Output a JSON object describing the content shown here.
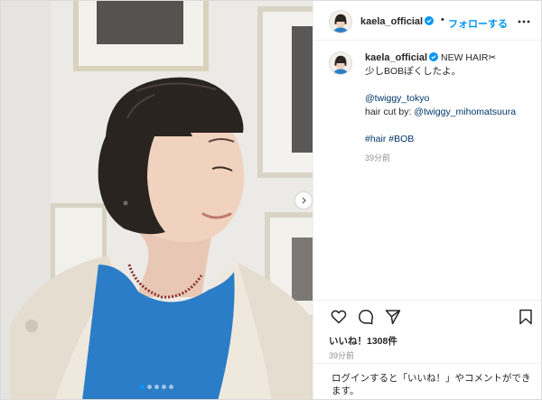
{
  "post": {
    "username": "kaela_official",
    "separator": "•",
    "follow_label": "フォローする",
    "more_icon": "more-horizontal-icon",
    "verified_icon": "verified-badge-icon",
    "caption": {
      "username": "kaela_official",
      "line1": " NEW HAIR✂",
      "line2": "少しBOBぽくしたよ。",
      "mention1": "@twiggy_tokyo",
      "haircut_prefix": "hair cut by: ",
      "mention2": "@twiggy_mihomatsuura",
      "hashtag1": "#hair",
      "hashtag2": "#BOB",
      "time": "39分前"
    },
    "actions": {
      "like_icon": "heart-icon",
      "comment_icon": "comment-icon",
      "share_icon": "send-icon",
      "save_icon": "bookmark-icon"
    },
    "likes_text": "いいね！1308件",
    "posted_time": "39分前",
    "login_prompt": "ログインすると「いいね！」やコメントができます。",
    "carousel": {
      "slide_count": 5,
      "active_slide": 1,
      "next_icon": "chevron-right-icon"
    }
  },
  "colors": {
    "accent": "#0095f6",
    "link": "#00376b",
    "text": "#262626",
    "muted": "#8e8e8e",
    "border": "#dbdbdb"
  }
}
